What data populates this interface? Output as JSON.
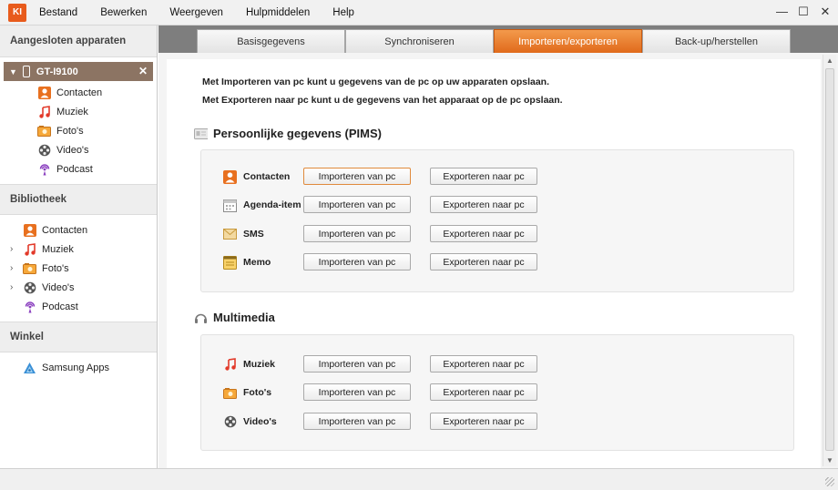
{
  "app": {
    "logo": "KI"
  },
  "menu": [
    "Bestand",
    "Bewerken",
    "Weergeven",
    "Hulpmiddelen",
    "Help"
  ],
  "window_controls": [
    "—",
    "☐",
    "✕"
  ],
  "sidebar": {
    "connected_header": "Aangesloten apparaten",
    "device": {
      "name": "GT-I9100",
      "close": "✕"
    },
    "device_items": [
      {
        "label": "Contacten",
        "icon": "contacts-icon"
      },
      {
        "label": "Muziek",
        "icon": "music-icon"
      },
      {
        "label": "Foto's",
        "icon": "photo-icon"
      },
      {
        "label": "Video's",
        "icon": "video-icon"
      },
      {
        "label": "Podcast",
        "icon": "podcast-icon"
      }
    ],
    "library_header": "Bibliotheek",
    "library_items": [
      {
        "label": "Contacten",
        "icon": "contacts-icon",
        "expandable": false
      },
      {
        "label": "Muziek",
        "icon": "music-icon",
        "expandable": true
      },
      {
        "label": "Foto's",
        "icon": "photo-icon",
        "expandable": true
      },
      {
        "label": "Video's",
        "icon": "video-icon",
        "expandable": true
      },
      {
        "label": "Podcast",
        "icon": "podcast-icon",
        "expandable": false
      }
    ],
    "store_header": "Winkel",
    "store_items": [
      {
        "label": "Samsung Apps",
        "icon": "samsung-apps-icon"
      }
    ]
  },
  "tabs": [
    {
      "label": "Basisgegevens",
      "active": false
    },
    {
      "label": "Synchroniseren",
      "active": false
    },
    {
      "label": "Importeren/exporteren",
      "active": true
    },
    {
      "label": "Back-up/herstellen",
      "active": false
    }
  ],
  "intro": {
    "line1": "Met Importeren van pc kunt u gegevens van de pc op uw apparaten opslaan.",
    "line2": "Met Exporteren naar pc kunt u de gegevens van het apparaat op de pc opslaan."
  },
  "pims": {
    "title": "Persoonlijke gegevens (PIMS)",
    "rows": [
      {
        "label": "Contacten",
        "icon": "contacts-icon"
      },
      {
        "label": "Agenda-item",
        "icon": "calendar-icon"
      },
      {
        "label": "SMS",
        "icon": "sms-icon"
      },
      {
        "label": "Memo",
        "icon": "memo-icon"
      }
    ]
  },
  "multimedia": {
    "title": "Multimedia",
    "rows": [
      {
        "label": "Muziek",
        "icon": "music-icon"
      },
      {
        "label": "Foto's",
        "icon": "photo-icon"
      },
      {
        "label": "Video's",
        "icon": "video-icon"
      }
    ]
  },
  "buttons": {
    "import": "Importeren van pc",
    "export": "Exporteren naar pc"
  },
  "colors": {
    "accent": "#e8701f",
    "device_bg": "#8c7463",
    "tab_bar": "#7e7e7e"
  }
}
